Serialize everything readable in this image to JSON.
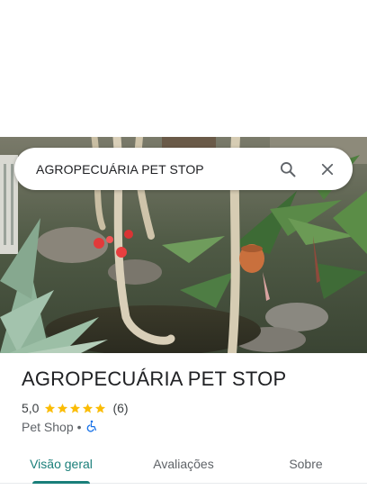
{
  "search": {
    "value": "AGROPECUÁRIA PET STOP",
    "search_icon": "search-icon",
    "clear_icon": "close-icon"
  },
  "place": {
    "name": "AGROPECUÁRIA PET STOP",
    "rating": "5,0",
    "stars": 5,
    "reviews": "(6)",
    "category": "Pet Shop",
    "separator": "•",
    "accessibility_icon": "wheelchair-icon"
  },
  "tabs": [
    {
      "label": "Visão geral",
      "active": true
    },
    {
      "label": "Avaliações",
      "active": false
    },
    {
      "label": "Sobre",
      "active": false
    }
  ],
  "colors": {
    "accent": "#1a7f7a",
    "star": "#fbbc04",
    "accessibility": "#1a73e8"
  }
}
